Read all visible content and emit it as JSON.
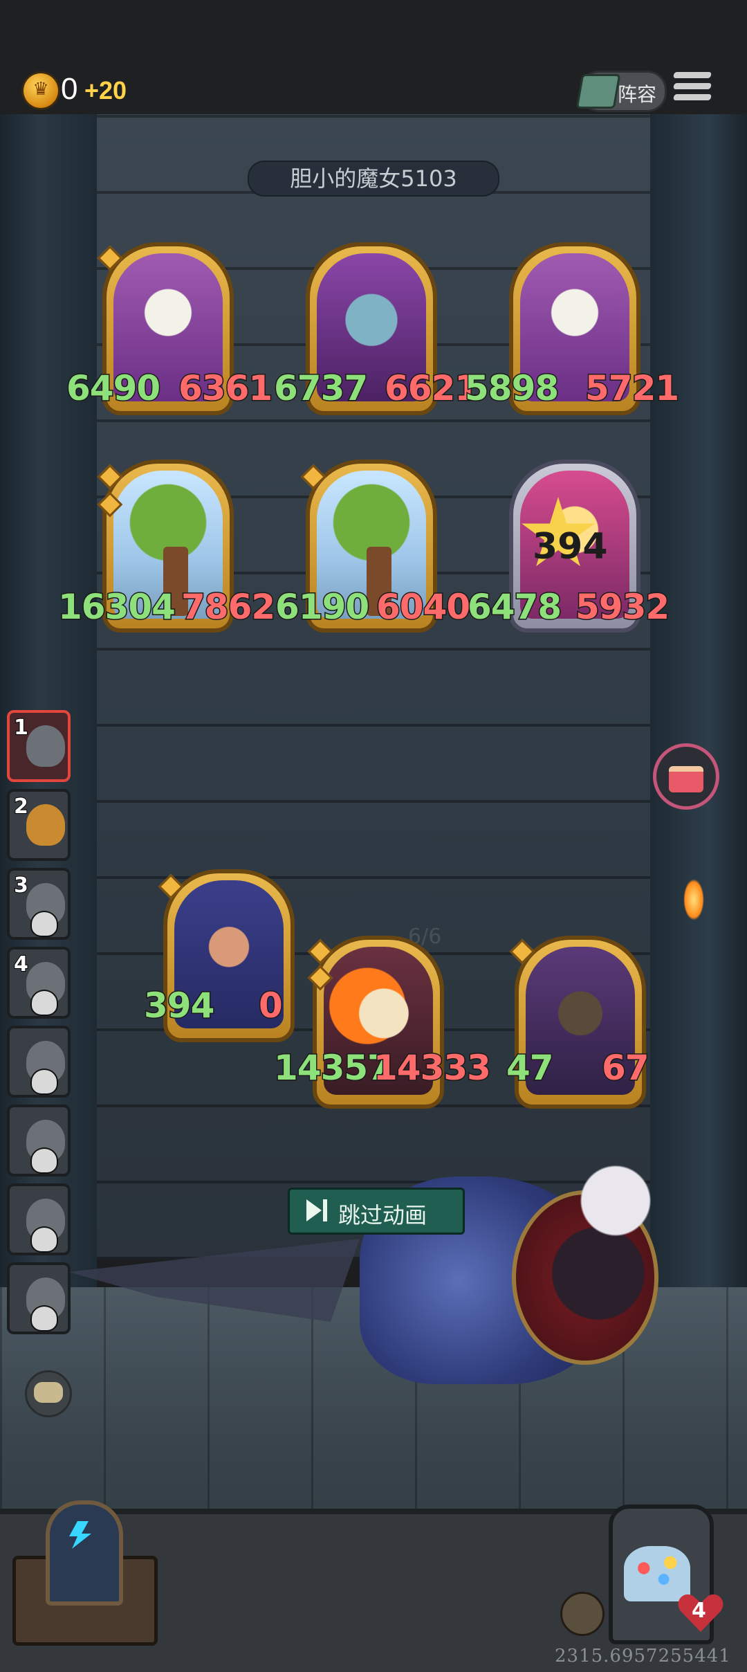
{
  "header": {
    "gold": "0",
    "gold_bonus": "+20",
    "lineup_label": "阵容"
  },
  "enemy": {
    "name": "胆小的魔女5103",
    "row1": [
      {
        "atk": "6490",
        "hp": "6361",
        "icon": "flower-spirit"
      },
      {
        "atk": "6737",
        "hp": "6621",
        "icon": "elf-witch"
      },
      {
        "atk": "5898",
        "hp": "5721",
        "icon": "flower-spirit"
      }
    ],
    "row2": [
      {
        "atk": "16304",
        "hp": "7862",
        "icon": "great-tree"
      },
      {
        "atk": "6190",
        "hp": "6040",
        "icon": "great-tree"
      },
      {
        "atk": "6478",
        "hp": "5932",
        "icon": "star-girl"
      }
    ],
    "damage_popup": "394"
  },
  "player": {
    "units": [
      {
        "atk": "394",
        "hp": "0",
        "icon": "bear-wizard"
      },
      {
        "atk": "14357",
        "hp": "14333",
        "icon": "fire-horse"
      },
      {
        "atk": "47",
        "hp": "67",
        "icon": "treant"
      }
    ],
    "faint_counter": "6/6"
  },
  "queue": [
    {
      "num": "1",
      "active": true,
      "icon": "elf-portrait"
    },
    {
      "num": "2",
      "active": false,
      "icon": "treasure-portrait"
    },
    {
      "num": "3",
      "active": false,
      "icon": "skull-portrait"
    },
    {
      "num": "4",
      "active": false,
      "icon": "skull-portrait"
    },
    {
      "num": "",
      "active": false,
      "icon": "skull-portrait"
    },
    {
      "num": "",
      "active": false,
      "icon": "skull-portrait"
    },
    {
      "num": "",
      "active": false,
      "icon": "skull-portrait"
    },
    {
      "num": "",
      "active": false,
      "icon": "skull-portrait"
    }
  ],
  "skip_label": "跳过动画",
  "lives": "4",
  "coords": "2315.6957255441",
  "colors": {
    "atk": "#8de07a",
    "hp": "#ff6b6b",
    "skip_bg": "#1f5e50"
  }
}
